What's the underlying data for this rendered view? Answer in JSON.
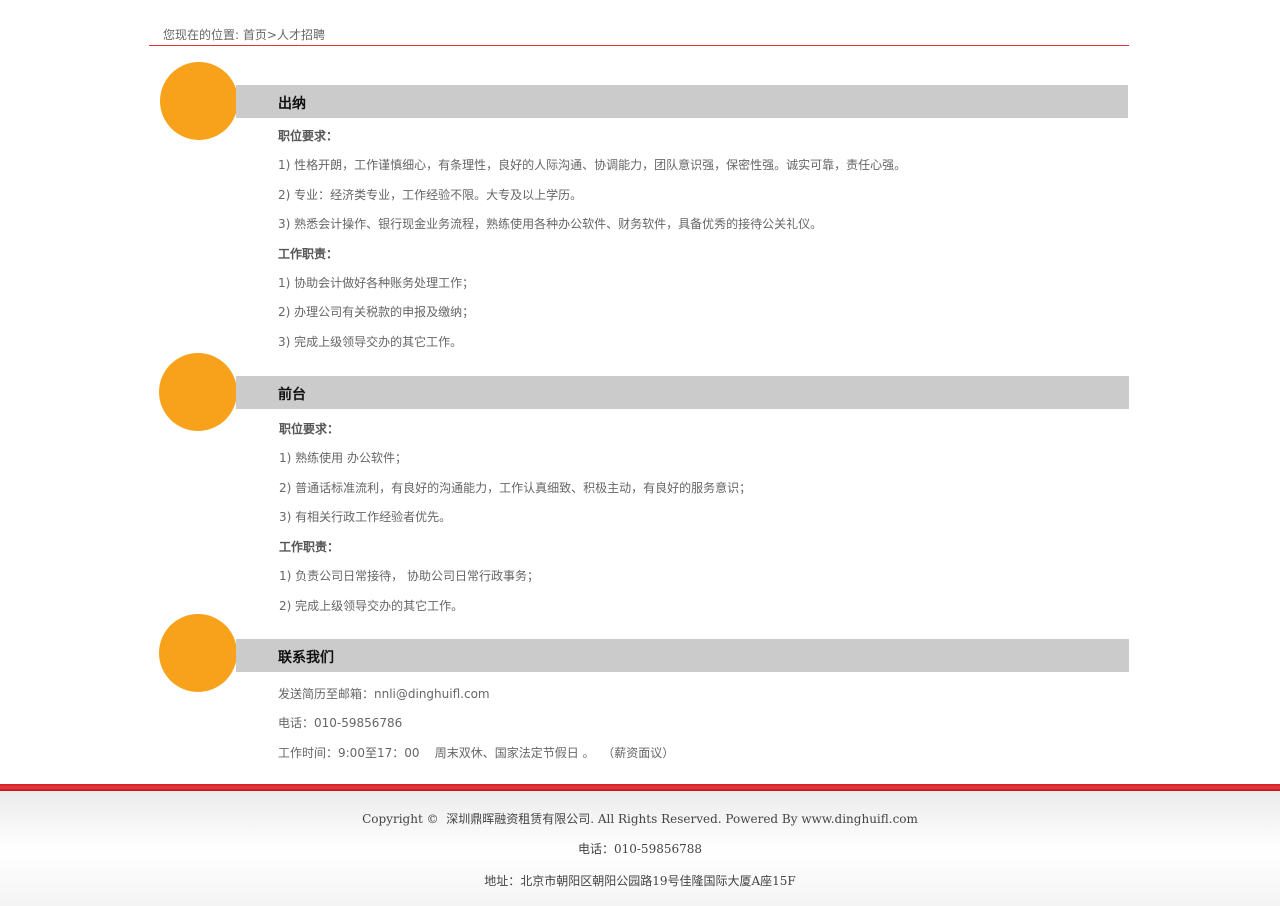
{
  "breadcrumb": {
    "prefix": "您现在的位置:",
    "home": "首页",
    "separator": ">",
    "current": "人才招聘"
  },
  "sections": [
    {
      "title": "出纳",
      "lines": [
        {
          "text": "职位要求：",
          "bold": true
        },
        {
          "text": "1) 性格开朗，工作谨慎细心，有条理性，良好的人际沟通、协调能力，团队意识强，保密性强。诚实可靠，责任心强。",
          "bold": false
        },
        {
          "text": "2) 专业：经济类专业，工作经验不限。大专及以上学历。",
          "bold": false
        },
        {
          "text": "3)  熟悉会计操作、银行现金业务流程，熟练使用各种办公软件、财务软件，具备优秀的接待公关礼仪。",
          "bold": false
        },
        {
          "text": "工作职责：",
          "bold": true
        },
        {
          "text": "1) 协助会计做好各种账务处理工作；",
          "bold": false
        },
        {
          "text": "2) 办理公司有关税款的申报及缴纳；",
          "bold": false
        },
        {
          "text": "3) 完成上级领导交办的其它工作。",
          "bold": false
        }
      ]
    },
    {
      "title": "前台",
      "lines": [
        {
          "text": "职位要求：",
          "bold": true
        },
        {
          "text": "1) 熟练使用 办公软件；",
          "bold": false
        },
        {
          "text": "2) 普通话标准流利，有良好的沟通能力，工作认真细致、积极主动，有良好的服务意识；",
          "bold": false
        },
        {
          "text": "3) 有相关行政工作经验者优先。",
          "bold": false
        },
        {
          "text": "工作职责：",
          "bold": true
        },
        {
          "text": "1) 负责公司日常接待， 协助公司日常行政事务；",
          "bold": false
        },
        {
          "text": "2) 完成上级领导交办的其它工作。",
          "bold": false
        }
      ]
    },
    {
      "title": "联系我们",
      "lines": [
        {
          "text": "发送简历至邮箱：nnli@dinghuifl.com",
          "bold": false
        },
        {
          "text": "电话：010-59856786",
          "bold": false
        },
        {
          "text": "工作时间：9:00至17：00    周末双休、国家法定节假日 。  （薪资面议）",
          "bold": false
        }
      ]
    }
  ],
  "footer": {
    "copyright": "Copyright ©  深圳鼎晖融资租赁有限公司. All Rights Reserved. Powered By www.dinghuifl.com",
    "phone": "电话：010-59856788",
    "address": "地址：北京市朝阳区朝阳公园路19号佳隆国际大厦A座15F"
  },
  "colors": {
    "accent_circle": "#f8a11a",
    "bar_gray": "#cbcbcb",
    "footer_red": "#d11d25",
    "breadcrumb_rule": "#e0353b"
  }
}
